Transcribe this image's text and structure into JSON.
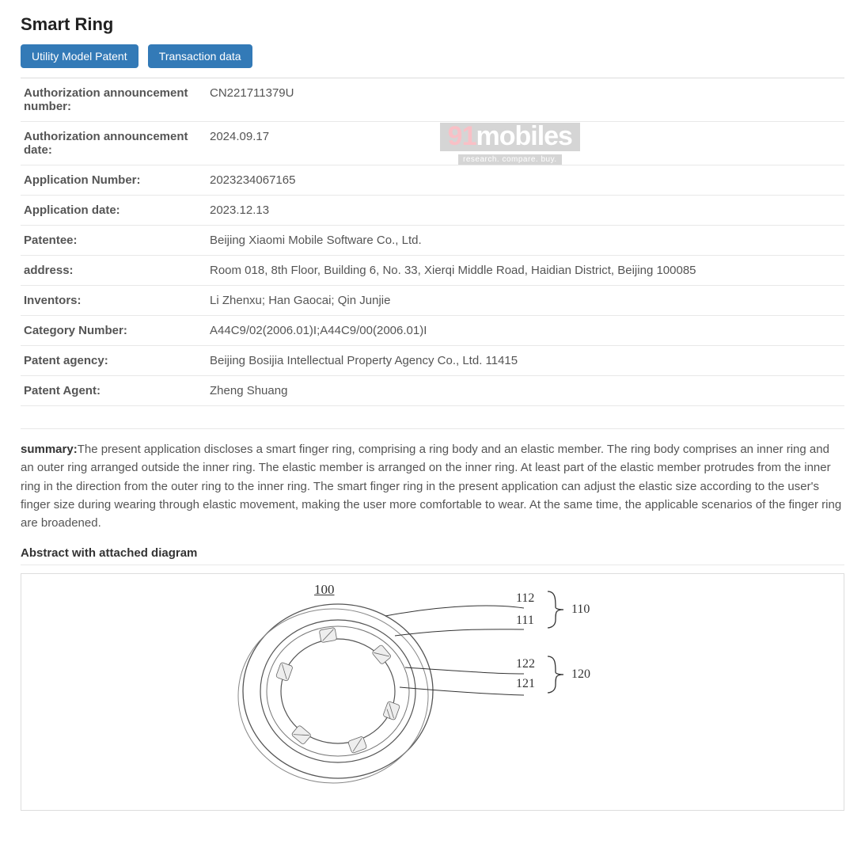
{
  "title": "Smart Ring",
  "buttons": {
    "utility": "Utility Model Patent",
    "transaction": "Transaction data"
  },
  "fields": [
    {
      "label": "Authorization announcement number:",
      "value": "CN221711379U"
    },
    {
      "label": "Authorization announcement date:",
      "value": "2024.09.17"
    },
    {
      "label": "Application Number:",
      "value": "2023234067165"
    },
    {
      "label": "Application date:",
      "value": "2023.12.13"
    },
    {
      "label": "Patentee:",
      "value": "Beijing Xiaomi Mobile Software Co., Ltd."
    },
    {
      "label": "address:",
      "value": "Room 018, 8th Floor, Building 6, No. 33, Xierqi Middle Road, Haidian District, Beijing 100085"
    },
    {
      "label": "Inventors:",
      "value": "Li Zhenxu; Han Gaocai; Qin Junjie"
    },
    {
      "label": "Category Number:",
      "value": "A44C9/02(2006.01)I;A44C9/00(2006.01)I"
    },
    {
      "label": "Patent agency:",
      "value": "Beijing Bosijia Intellectual Property Agency Co., Ltd. 11415"
    },
    {
      "label": "Patent Agent:",
      "value": "Zheng Shuang"
    }
  ],
  "summary": {
    "label": "summary:",
    "text": "The present application discloses a smart finger ring, comprising a ring body and an elastic member. The ring body comprises an inner ring and an outer ring arranged outside the inner ring. The elastic member is arranged on the inner ring. At least part of the elastic member protrudes from the inner ring in the direction from the outer ring to the inner ring. The smart finger ring in the present application can adjust the elastic size according to the user's finger size during wearing through elastic movement, making the user more comfortable to wear. At the same time, the applicable scenarios of the finger ring are broadened."
  },
  "abstract_heading": "Abstract with attached diagram",
  "diagram": {
    "figure_ref": "100",
    "callouts": [
      "112",
      "111",
      "110",
      "122",
      "121",
      "120"
    ]
  },
  "watermark": {
    "brand_prefix": "91",
    "brand_main": "mobiles",
    "tagline": "research. compare. buy."
  }
}
